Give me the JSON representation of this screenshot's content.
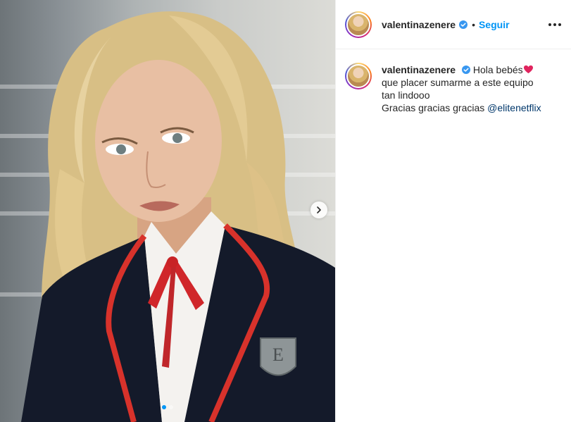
{
  "post": {
    "username": "valentinazenere",
    "follow_separator": "•",
    "follow_label": "Seguir",
    "caption": {
      "line1": "Hola bebés",
      "line2": "que placer sumarme a este equipo",
      "line3": "tan lindooo",
      "line4_text": "Gracias gracias gracias",
      "mention": "@elitenetflix"
    },
    "carousel": {
      "slides": 2,
      "active": 1
    }
  },
  "colors": {
    "link": "#0095f6",
    "mention": "#00376b",
    "text": "#262626",
    "verified": "#3897f0",
    "heart": "#e0245e"
  },
  "icons": [
    "verified-badge-icon",
    "heart-emoji",
    "more-options-icon",
    "chevron-right-icon"
  ]
}
